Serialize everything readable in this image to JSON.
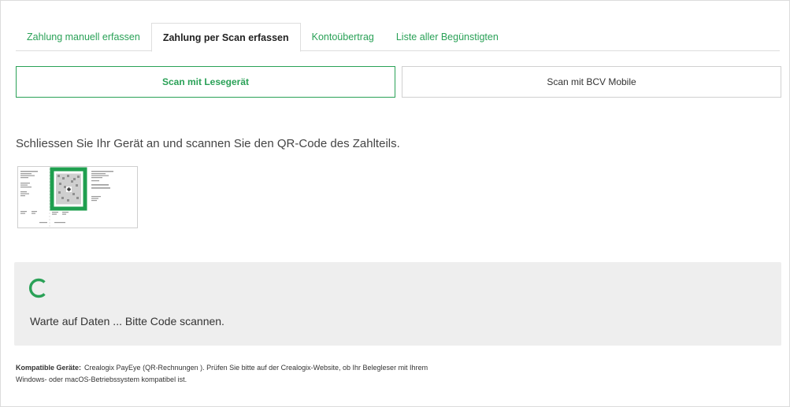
{
  "tabs": [
    {
      "label": "Zahlung manuell erfassen",
      "active": false
    },
    {
      "label": "Zahlung per Scan erfassen",
      "active": true
    },
    {
      "label": "Kontoübertrag",
      "active": false
    },
    {
      "label": "Liste aller Begünstigten",
      "active": false
    }
  ],
  "scan_options": {
    "reader": "Scan mit Lesegerät",
    "mobile": "Scan mit BCV Mobile",
    "selected": "reader"
  },
  "instruction": "Schliessen Sie Ihr Gerät an und scannen Sie den QR-Code des Zahlteils.",
  "slip_icon": "qr-payment-slip-illustration",
  "status": {
    "icon": "loading-spinner-icon",
    "text": "Warte auf Daten ... Bitte Code scannen."
  },
  "compatibility": {
    "label": "Kompatible Geräte:",
    "line1": "Crealogix PayEye (QR-Rechnungen ). Prüfen Sie bitte auf der Crealogix-Website, ob Ihr Belegleser mit Ihrem",
    "line2": "Windows- oder macOS-Betriebssystem kompatibel ist."
  },
  "colors": {
    "accent": "#2aa157",
    "panel_bg": "#eeeeee",
    "border": "#dedede"
  }
}
